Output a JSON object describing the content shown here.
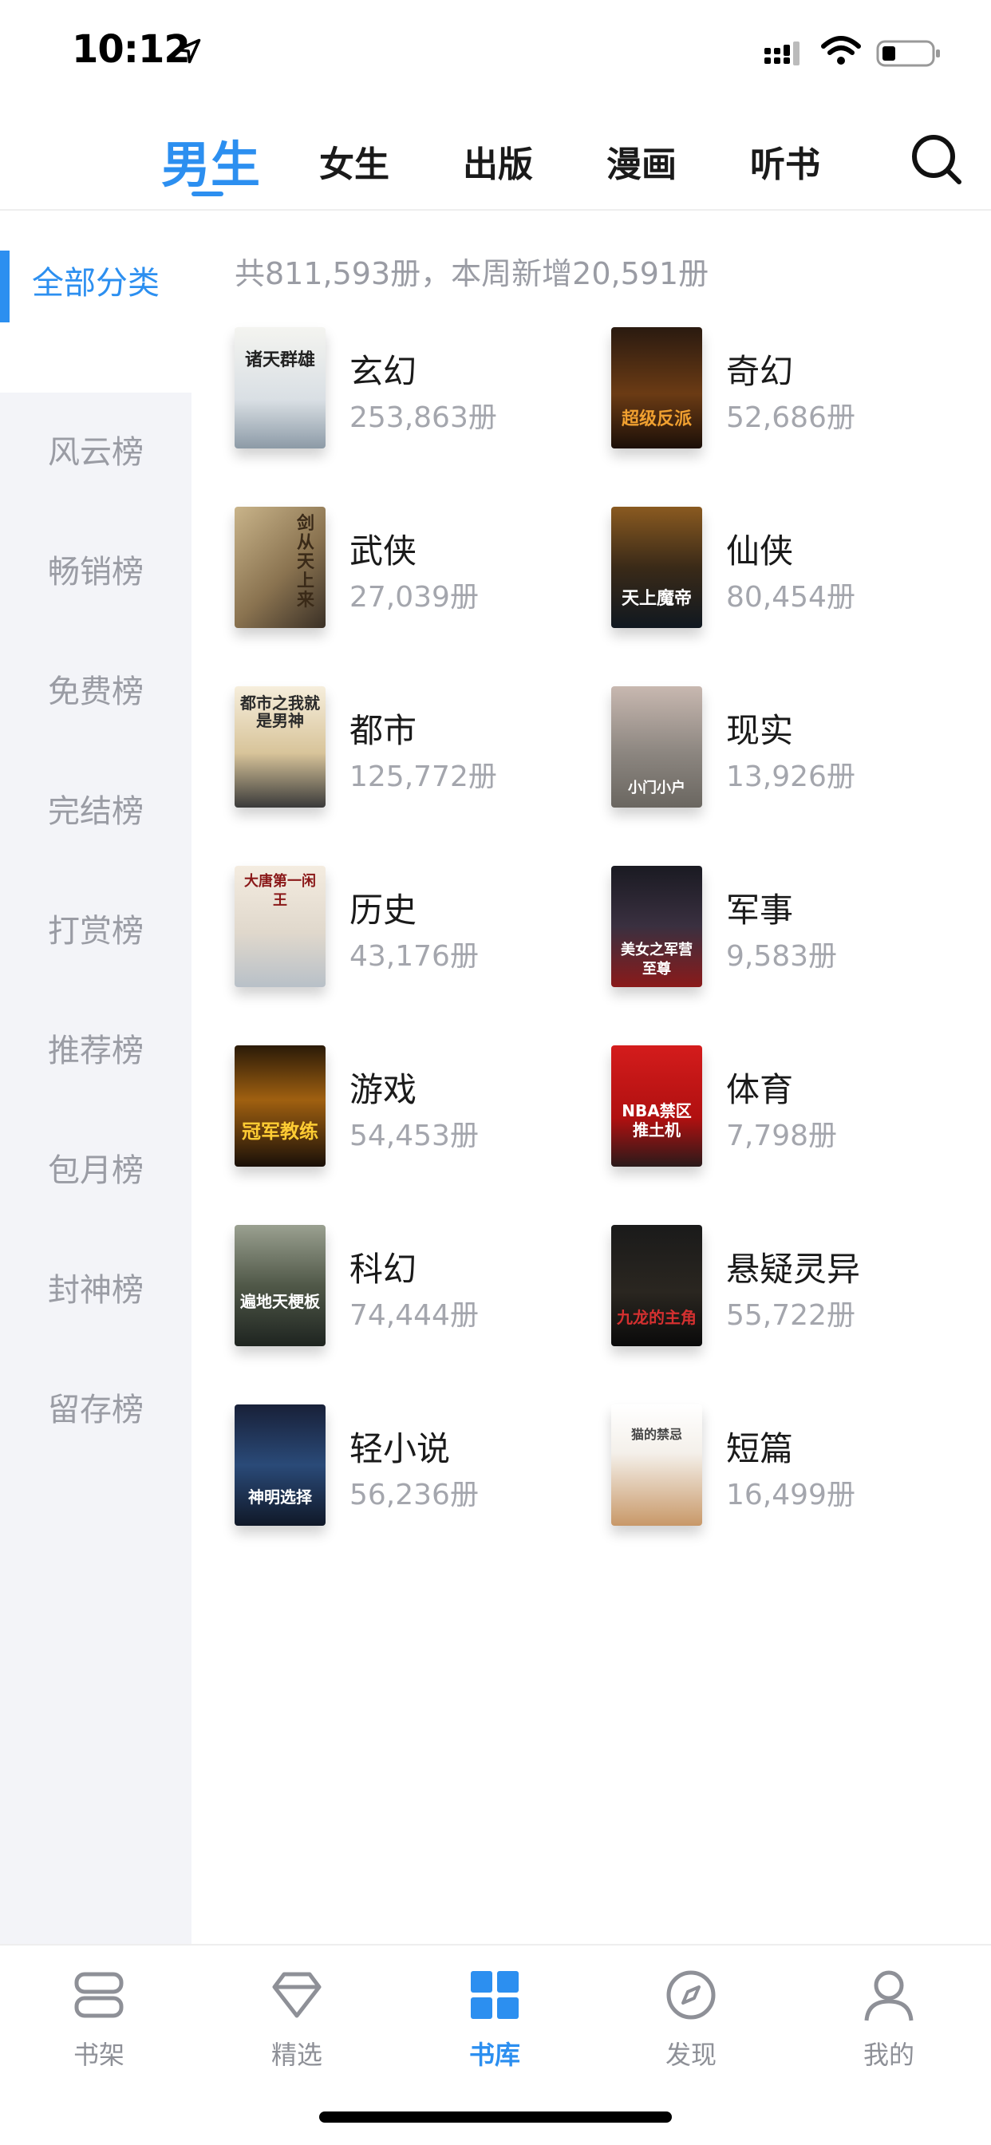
{
  "status": {
    "time": "10:12"
  },
  "top_tabs": [
    {
      "label": "男生",
      "active": true
    },
    {
      "label": "女生",
      "active": false
    },
    {
      "label": "出版",
      "active": false
    },
    {
      "label": "漫画",
      "active": false
    },
    {
      "label": "听书",
      "active": false
    }
  ],
  "sidebar": {
    "items": [
      {
        "label": "全部分类",
        "active": true
      },
      {
        "label": "风云榜"
      },
      {
        "label": "畅销榜"
      },
      {
        "label": "免费榜"
      },
      {
        "label": "完结榜"
      },
      {
        "label": "打赏榜"
      },
      {
        "label": "推荐榜"
      },
      {
        "label": "包月榜"
      },
      {
        "label": "封神榜"
      },
      {
        "label": "留存榜"
      }
    ]
  },
  "summary": "共811,593册，本周新增20,591册",
  "categories": [
    {
      "name": "玄幻",
      "count": "253,863册",
      "cover_text": "诸天群雄"
    },
    {
      "name": "奇幻",
      "count": "52,686册",
      "cover_text": "超级反派"
    },
    {
      "name": "武侠",
      "count": "27,039册",
      "cover_text": "剑从天上来"
    },
    {
      "name": "仙侠",
      "count": "80,454册",
      "cover_text": "天上魔帝"
    },
    {
      "name": "都市",
      "count": "125,772册",
      "cover_text": "都市之我就是男神"
    },
    {
      "name": "现实",
      "count": "13,926册",
      "cover_text": "小门小户"
    },
    {
      "name": "历史",
      "count": "43,176册",
      "cover_text": "大唐第一闲王"
    },
    {
      "name": "军事",
      "count": "9,583册",
      "cover_text": "美女之军营至尊"
    },
    {
      "name": "游戏",
      "count": "54,453册",
      "cover_text": "冠军教练"
    },
    {
      "name": "体育",
      "count": "7,798册",
      "cover_text": "NBA禁区推土机"
    },
    {
      "name": "科幻",
      "count": "74,444册",
      "cover_text": "遍地天梗板"
    },
    {
      "name": "悬疑灵异",
      "count": "55,722册",
      "cover_text": "九龙的主角"
    },
    {
      "name": "轻小说",
      "count": "56,236册",
      "cover_text": "神明选择"
    },
    {
      "name": "短篇",
      "count": "16,499册",
      "cover_text": "猫的禁忌"
    }
  ],
  "bottom_nav": [
    {
      "label": "书架",
      "icon": "bookshelf-icon",
      "active": false
    },
    {
      "label": "精选",
      "icon": "diamond-icon",
      "active": false
    },
    {
      "label": "书库",
      "icon": "grid-icon",
      "active": true
    },
    {
      "label": "发现",
      "icon": "compass-icon",
      "active": false
    },
    {
      "label": "我的",
      "icon": "person-icon",
      "active": false
    }
  ],
  "colors": {
    "accent": "#2c8ff0",
    "sidebar_bg": "#f3f4f8",
    "muted_text": "#9a9ca4"
  }
}
